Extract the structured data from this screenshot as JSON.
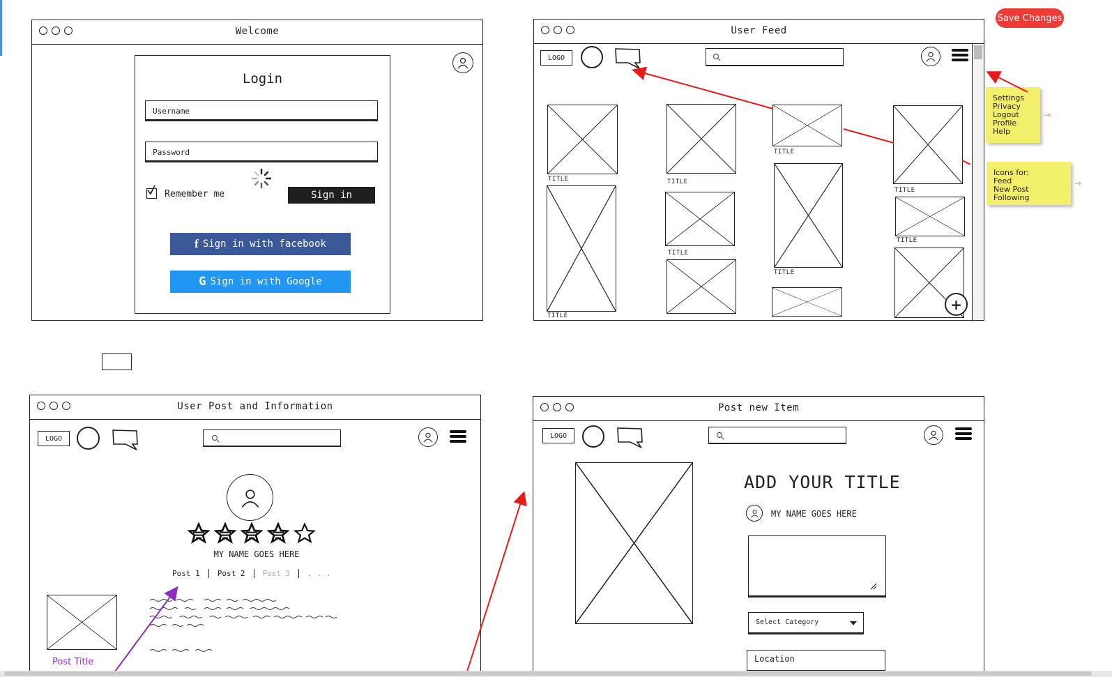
{
  "toolbar": {
    "save_label": "Save Changes",
    "save_color": "#ef3b35"
  },
  "login_window": {
    "title": "Welcome",
    "heading": "Login",
    "username_placeholder": "Username",
    "password_placeholder": "Password",
    "remember_label": "Remember me",
    "signin_label": "Sign in",
    "facebook_label": "Sign in with facebook",
    "google_label": "Sign in with Google",
    "facebook_color": "#3b5998",
    "google_color": "#2196f3"
  },
  "feed_window": {
    "title": "User Feed",
    "logo_label": "LOGO",
    "tile_caption": "TITLE",
    "menu_note": [
      "Settings",
      "Privacy",
      "Logout",
      "Profile",
      "Help"
    ],
    "icons_note": [
      "Icons for:",
      "Feed",
      "New Post",
      "Following"
    ],
    "add_label": "+"
  },
  "profile_window": {
    "title": "User Post and Information",
    "logo_label": "LOGO",
    "user_name": "MY NAME GOES HERE",
    "rating": 4,
    "rating_max": 5,
    "tabs": [
      "Post 1",
      "Post 2",
      "Post 3",
      ". . ."
    ],
    "post_title_annotation": "Post Title"
  },
  "newpost_window": {
    "title": "Post new Item",
    "logo_label": "LOGO",
    "heading": "ADD YOUR TITLE",
    "user_name": "MY NAME GOES HERE",
    "category_placeholder": "Select Category",
    "location_placeholder": "Location"
  }
}
